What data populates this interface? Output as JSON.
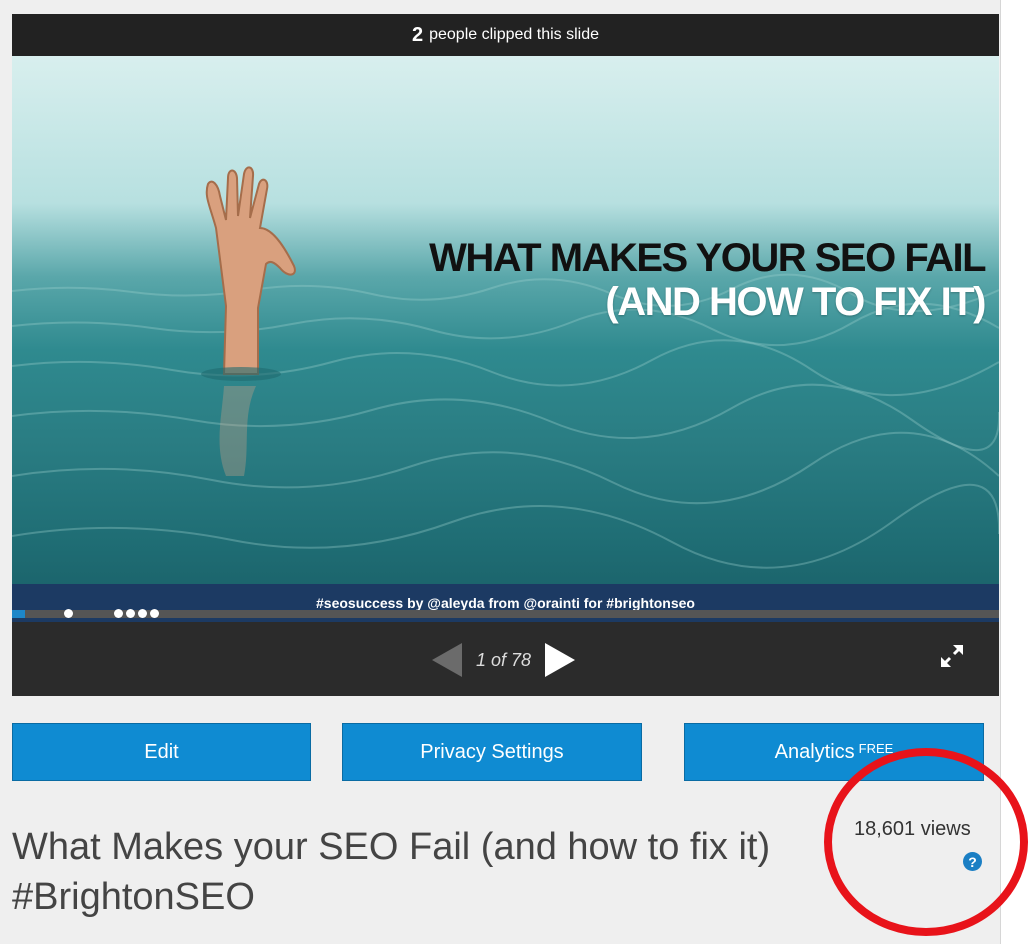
{
  "clip_banner": {
    "count": "2",
    "text": "people clipped this slide"
  },
  "slide": {
    "title_line1": "WHAT MAKES YOUR SEO FAIL",
    "title_line2": "(AND HOW TO FIX IT)",
    "footer": "#seosuccess by @aleyda from @orainti for #brightonseo"
  },
  "player": {
    "page_indicator": "1 of 78",
    "progress_fraction": 0.0128,
    "icons": {
      "prev": "triangle-left-icon",
      "next": "triangle-right-icon",
      "fullscreen": "expand-arrows-icon"
    }
  },
  "actions": {
    "edit_label": "Edit",
    "privacy_label": "Privacy Settings",
    "analytics_label": "Analytics",
    "analytics_badge": "FREE"
  },
  "presentation": {
    "title": "What Makes your SEO Fail (and how to fix it) #BrightonSEO",
    "views": "18,601 views",
    "help_icon": "question-circle-icon"
  },
  "colors": {
    "accent": "#0f8bd2",
    "annotation": "#e8131a",
    "slide_footer": "#1c3a63"
  }
}
